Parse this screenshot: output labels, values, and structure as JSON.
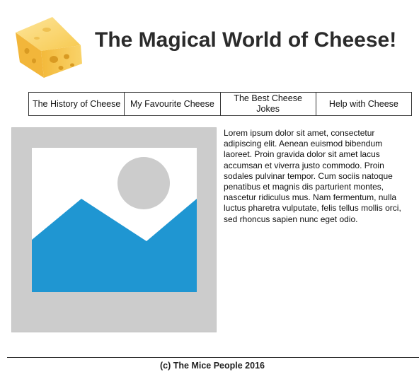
{
  "header": {
    "title": "The Magical World of Cheese!",
    "logo_icon": "cheese-icon"
  },
  "nav": {
    "items": [
      {
        "label": "The History of Cheese"
      },
      {
        "label": "My Favourite Cheese"
      },
      {
        "label": "The Best Cheese Jokes"
      },
      {
        "label": "Help with Cheese"
      }
    ]
  },
  "hero": {
    "icon": "image-placeholder-icon",
    "colors": {
      "frame": "#cccccc",
      "mountains": "#1f96d2",
      "sun": "#cccccc",
      "canvas": "#ffffff"
    }
  },
  "content": {
    "text": "Lorem ipsum dolor sit amet, consectetur adipiscing elit. Aenean euismod bibendum laoreet. Proin gravida dolor sit amet lacus accumsan et viverra justo commodo. Proin sodales pulvinar tempor. Cum sociis natoque penatibus et magnis dis parturient montes, nascetur ridiculus mus. Nam fermentum, nulla luctus pharetra vulputate, felis tellus mollis orci, sed rhoncus sapien nunc eget odio."
  },
  "footer": {
    "text": "(c) The Mice People 2016"
  }
}
